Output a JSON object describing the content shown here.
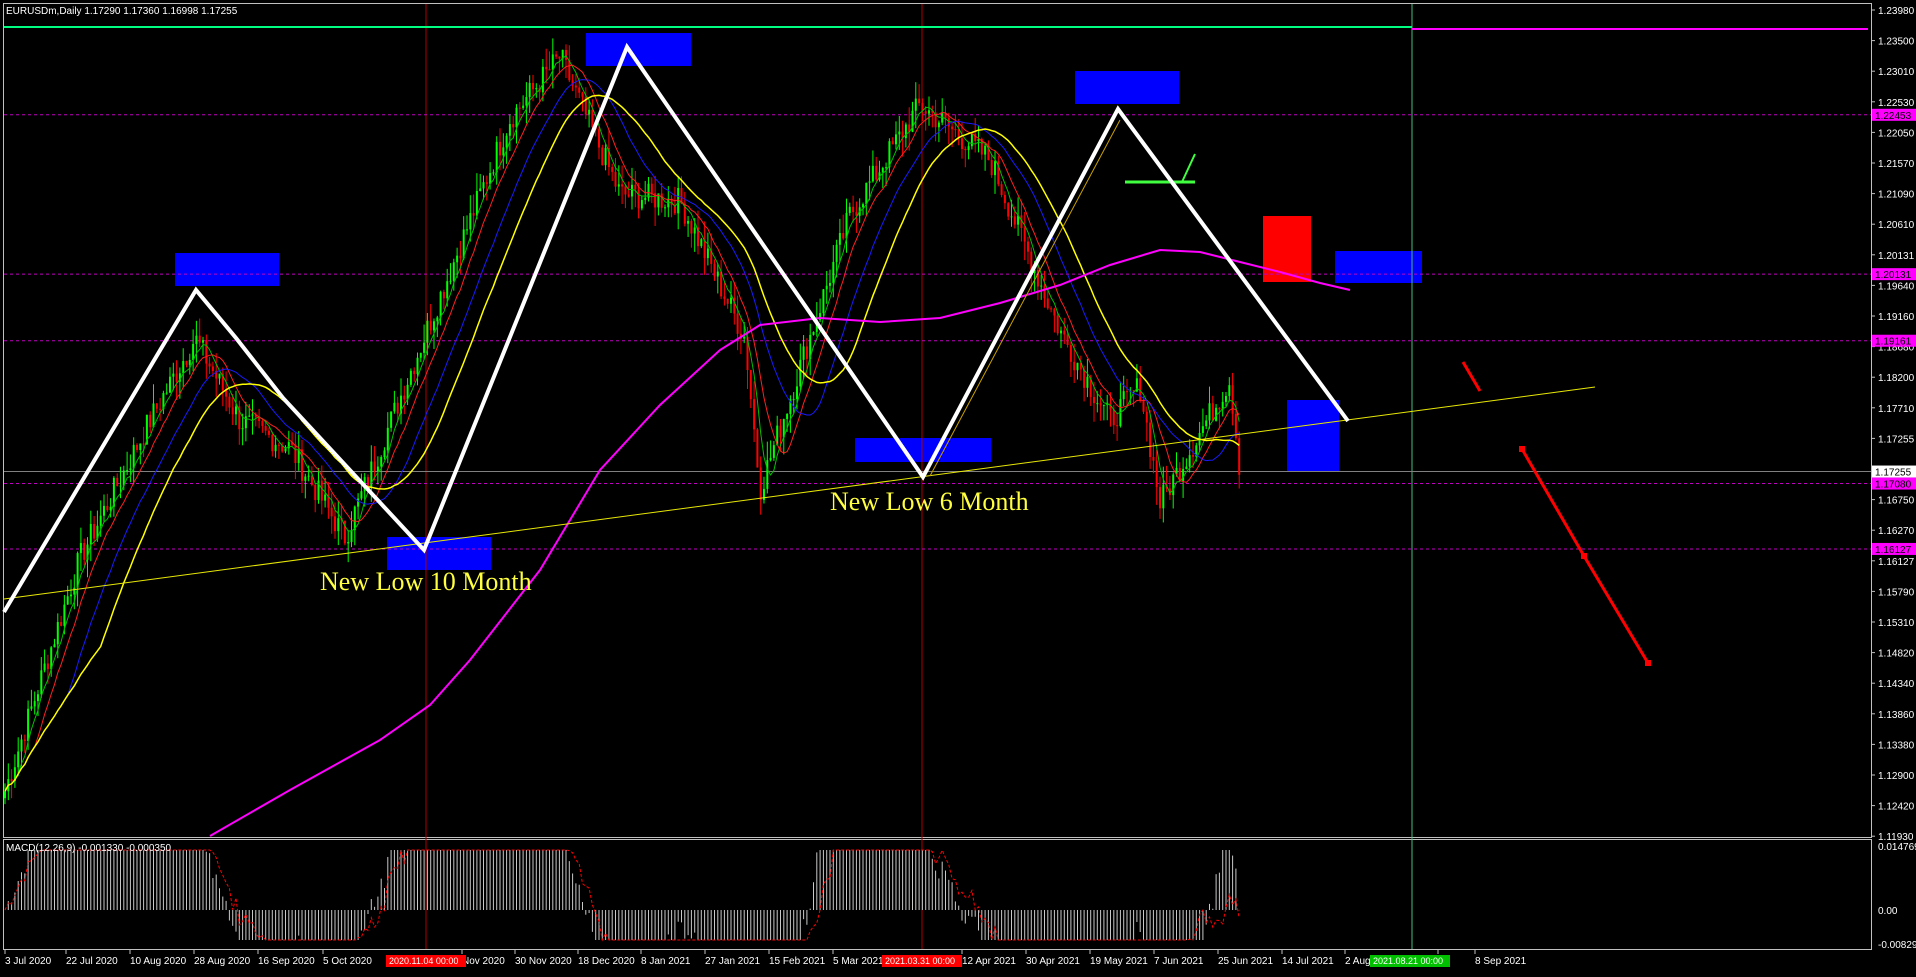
{
  "window": {
    "header": "EURUSDm,Daily  1.17290 1.17360 1.16998 1.17255"
  },
  "macd_panel": {
    "header": "MACD(12,26,9) -0.001330 -0.000350",
    "scale_labels": [
      "0.014769",
      "0.00",
      "-0.008294"
    ]
  },
  "price_scale": {
    "labels": [
      "1.23980",
      "1.23500",
      "1.23010",
      "1.22530",
      "1.22050",
      "1.21570",
      "1.21090",
      "1.20610",
      "1.20131",
      "1.19640",
      "1.19160",
      "1.18680",
      "1.18200",
      "1.17710",
      "1.17255",
      "1.17080",
      "1.16750",
      "1.16270",
      "1.16127",
      "1.15790",
      "1.15310",
      "1.14820",
      "1.14340",
      "1.13860",
      "1.13380",
      "1.12900",
      "1.12420",
      "1.11930"
    ],
    "badges": [
      {
        "text": "1.22453",
        "color": "#ff00ff"
      },
      {
        "text": "1.20131",
        "color": "#ff00ff"
      },
      {
        "text": "1.19161",
        "color": "#ff00ff"
      },
      {
        "text": "1.17255",
        "color": "#ffffff"
      },
      {
        "text": "1.17080",
        "color": "#ff00ff"
      },
      {
        "text": "1.16127",
        "color": "#ff00ff"
      }
    ]
  },
  "time_axis": {
    "labels": [
      "3 Jul 2020",
      "22 Jul 2020",
      "10 Aug 2020",
      "28 Aug 2020",
      "16 Sep 2020",
      "5 Oct 2020",
      "Nov 2020",
      "30 Nov 2020",
      "18 Dec 2020",
      "8 Jan 2021",
      "27 Jan 2021",
      "15 Feb 2021",
      "5 Mar 2021",
      "12 Apr 2021",
      "30 Apr 2021",
      "19 May 2021",
      "7 Jun 2021",
      "25 Jun 2021",
      "14 Jul 2021",
      "2 Aug",
      "21",
      "8 Sep 2021"
    ],
    "highlight_labels": [
      {
        "text": "2020.11.04 00:00",
        "color": "#ff0000"
      },
      {
        "text": "2021.03.31 00:00",
        "color": "#ff0000"
      },
      {
        "text": "2021.08.21 00:00",
        "color": "#00c000"
      }
    ]
  },
  "annotations": {
    "new_low_10": "New Low 10 Month",
    "new_low_6": "New Low 6 Month"
  },
  "colors": {
    "background": "#000000",
    "bull_candle": "#00ff00",
    "bear_candle": "#ff0000",
    "ma_yellow": "#ffff00",
    "ma_magenta": "#ff00ff",
    "ma_blue": "#1a1aff",
    "zone_blue": "#0000ff",
    "zone_red": "#ff0000",
    "level_line": "#c000c0",
    "top_line_green": "#00ff80"
  },
  "chart_data": {
    "type": "line",
    "symbol": "EURUSDm",
    "timeframe": "Daily",
    "last_bar": {
      "open": 1.1729,
      "high": 1.1736,
      "low": 1.16998,
      "close": 1.17255
    },
    "ylim": [
      1.1193,
      1.2398
    ],
    "x_date_range": [
      "3 Jul 2020",
      "21 Sep 2021"
    ],
    "price_path": [
      {
        "date": "3 Jul 2020",
        "price": 1.126
      },
      {
        "date": "22 Jul 2020",
        "price": 1.16
      },
      {
        "date": "10 Aug 2020",
        "price": 1.18
      },
      {
        "date": "28 Aug 2020",
        "price": 1.192
      },
      {
        "date": "16 Sep 2020",
        "price": 1.18
      },
      {
        "date": "5 Oct 2020",
        "price": 1.176
      },
      {
        "date": "4 Nov 2020",
        "price": 1.163
      },
      {
        "date": "30 Nov 2020",
        "price": 1.198
      },
      {
        "date": "18 Dec 2020",
        "price": 1.224
      },
      {
        "date": "6 Jan 2021",
        "price": 1.233
      },
      {
        "date": "27 Jan 2021",
        "price": 1.213
      },
      {
        "date": "15 Feb 2021",
        "price": 1.212
      },
      {
        "date": "5 Mar 2021",
        "price": 1.192
      },
      {
        "date": "31 Mar 2021",
        "price": 1.17
      },
      {
        "date": "30 Apr 2021",
        "price": 1.21
      },
      {
        "date": "25 May 2021",
        "price": 1.226
      },
      {
        "date": "7 Jun 2021",
        "price": 1.218
      },
      {
        "date": "25 Jun 2021",
        "price": 1.193
      },
      {
        "date": "14 Jul 2021",
        "price": 1.18
      },
      {
        "date": "2 Aug 2021",
        "price": 1.185
      },
      {
        "date": "21 Aug 2021",
        "price": 1.168
      },
      {
        "date": "8 Sep 2021",
        "price": 1.186
      },
      {
        "date": "21 Sep 2021",
        "price": 1.1726
      }
    ],
    "levels": [
      1.22453,
      1.20131,
      1.19161,
      1.1708,
      1.16127
    ]
  }
}
